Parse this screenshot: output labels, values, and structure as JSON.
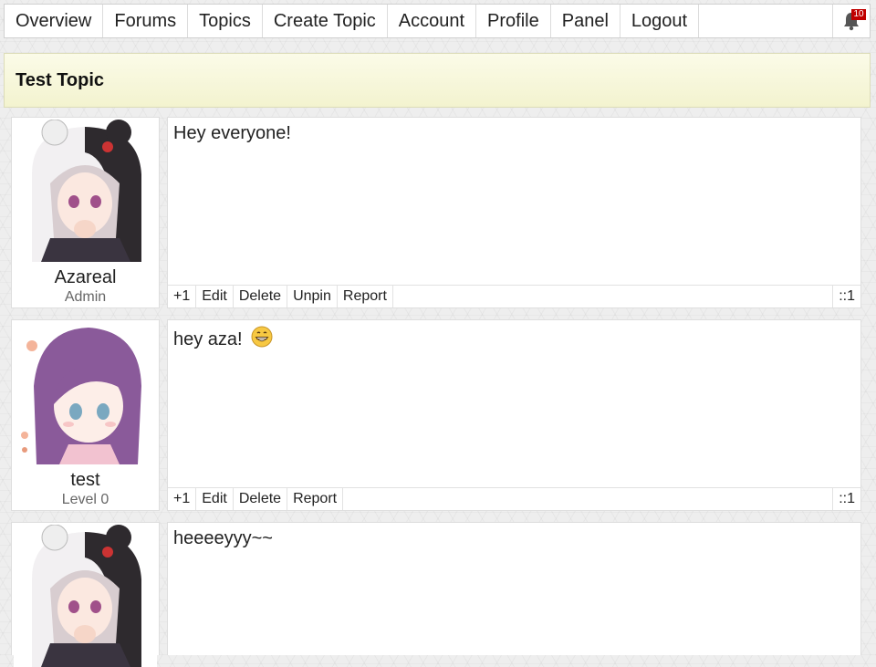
{
  "nav": {
    "items": [
      "Overview",
      "Forums",
      "Topics",
      "Create Topic",
      "Account",
      "Profile",
      "Panel",
      "Logout"
    ],
    "notifications_count": "10",
    "bell_icon": "bell-icon"
  },
  "topic": {
    "title": "Test Topic"
  },
  "posts": [
    {
      "username": "Azareal",
      "level": "Admin",
      "content": "Hey everyone!",
      "actions": [
        "+1",
        "Edit",
        "Delete",
        "Unpin",
        "Report"
      ],
      "count": "::1",
      "avatar_icon": "avatar-panda-hood"
    },
    {
      "username": "test",
      "level": "Level 0",
      "content": "hey aza!",
      "emoji": "grin-emoji-icon",
      "actions": [
        "+1",
        "Edit",
        "Delete",
        "Report"
      ],
      "count": "::1",
      "avatar_icon": "avatar-purple-hair"
    },
    {
      "username": "",
      "level": "",
      "content": "heeeeyyy~~",
      "actions": [],
      "count": "",
      "avatar_icon": "avatar-panda-hood"
    }
  ],
  "colors": {
    "header_bg": "#f6f6d8",
    "badge": "#c00000",
    "purple_hair": "#8a5a9a"
  }
}
